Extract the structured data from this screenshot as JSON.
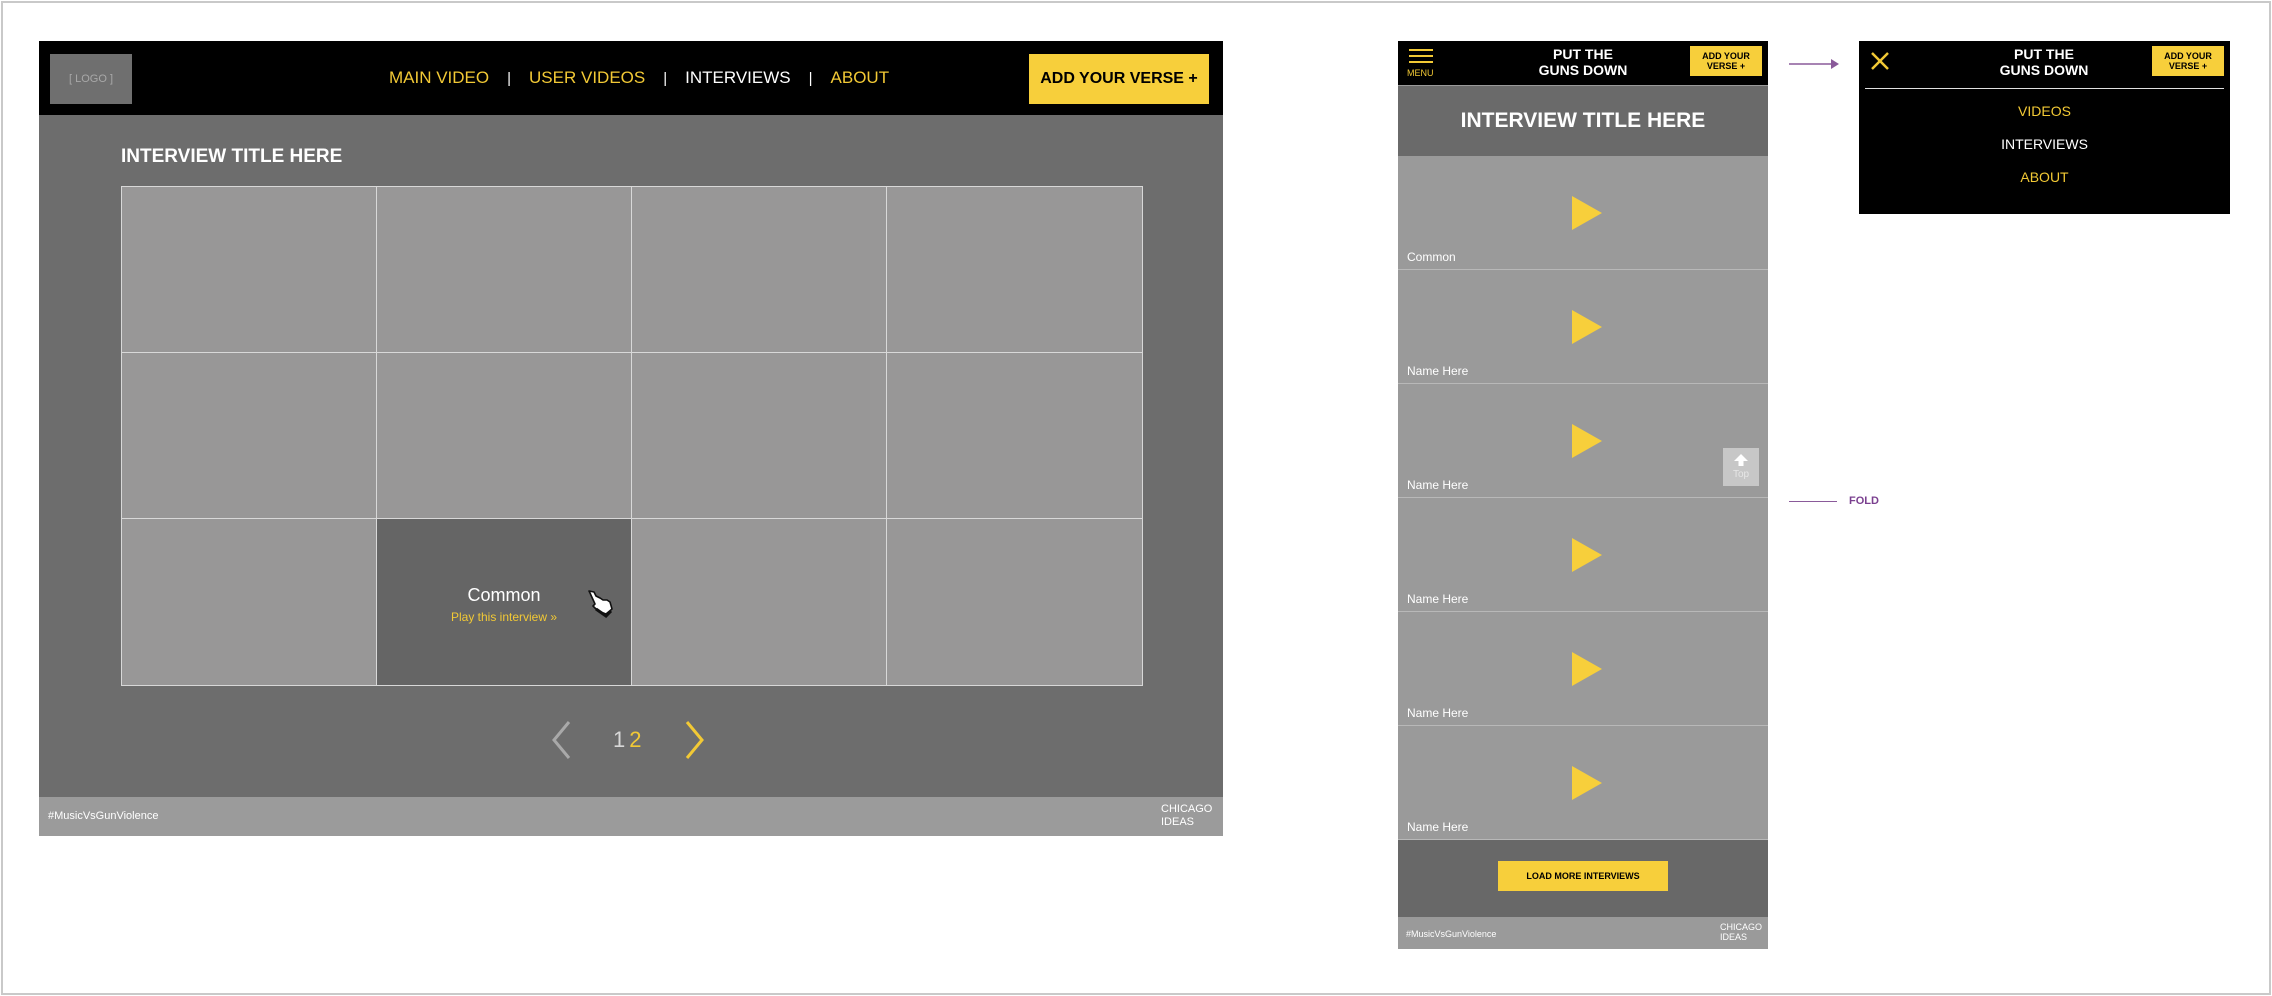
{
  "desktop": {
    "logo": "[ LOGO ]",
    "nav": {
      "main_video": "MAIN VIDEO",
      "user_videos": "USER VIDEOS",
      "interviews": "INTERVIEWS",
      "about": "ABOUT",
      "separator": "|"
    },
    "cta": "ADD YOUR VERSE +",
    "title": "INTERVIEW TITLE HERE",
    "hover_card": {
      "name": "Common",
      "link": "Play this interview »"
    },
    "pagination": {
      "page1": "1",
      "page2": "2"
    },
    "footer": {
      "hashtag": "#MusicVsGunViolence",
      "brand": "CHICAGO IDEAS"
    }
  },
  "mobile": {
    "menu_label": "MENU",
    "brand": "PUT THE GUNS DOWN",
    "cta": "ADD YOUR VERSE +",
    "title": "INTERVIEW TITLE HERE",
    "items": [
      {
        "name": "Common"
      },
      {
        "name": "Name Here"
      },
      {
        "name": "Name Here"
      },
      {
        "name": "Name Here"
      },
      {
        "name": "Name Here"
      },
      {
        "name": "Name Here"
      }
    ],
    "top_button": "Top",
    "load_more": "LOAD MORE INTERVIEWS",
    "footer": {
      "hashtag": "#MusicVsGunViolence",
      "brand": "CHICAGO IDEAS"
    }
  },
  "annotations": {
    "fold": "FOLD"
  },
  "menu_open": {
    "brand": "PUT THE GUNS DOWN",
    "cta": "ADD YOUR VERSE +",
    "links": {
      "videos": "VIDEOS",
      "interviews": "INTERVIEWS",
      "about": "ABOUT"
    }
  },
  "colors": {
    "accent": "#f7cf3b",
    "link_yellow": "#f2c935",
    "header_bg": "#000000",
    "panel_gray": "#6d6d6d",
    "tile_gray": "#989797",
    "annotation_purple": "#8a5a9a"
  }
}
